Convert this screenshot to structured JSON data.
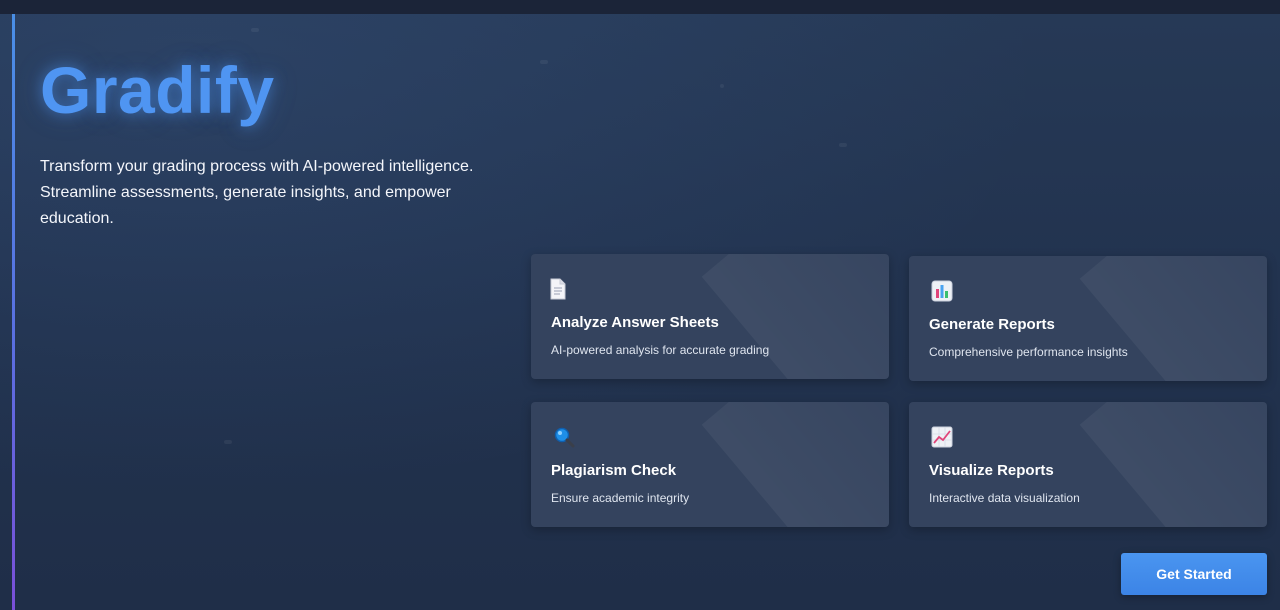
{
  "hero": {
    "title": "Gradify",
    "tagline": "Transform your grading process with AI-powered intelligence. Streamline assessments, generate insights, and empower education."
  },
  "features": [
    {
      "icon": "document-icon",
      "title": "Analyze Answer Sheets",
      "description": "AI-powered analysis for accurate grading"
    },
    {
      "icon": "bar-chart-icon",
      "title": "Generate Reports",
      "description": "Comprehensive performance insights"
    },
    {
      "icon": "magnifier-icon",
      "title": "Plagiarism Check",
      "description": "Ensure academic integrity"
    },
    {
      "icon": "line-chart-icon",
      "title": "Visualize Reports",
      "description": "Interactive data visualization"
    }
  ],
  "cta": {
    "label": "Get Started"
  },
  "colors": {
    "accent": "#4f95f2",
    "background": "#22334f",
    "card": "#34435e",
    "button": "#3c84e6"
  }
}
